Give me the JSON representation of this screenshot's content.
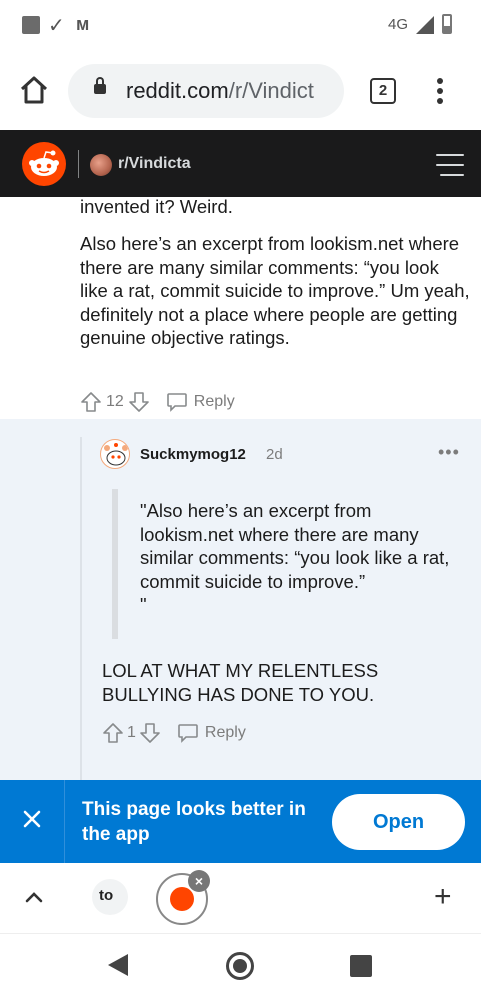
{
  "status_bar": {
    "network": "4G",
    "icons": [
      "app-square-icon",
      "check-icon",
      "malwarebytes-icon",
      "signal-icon",
      "battery-icon"
    ]
  },
  "browser": {
    "url_host": "reddit.com",
    "url_path": "/r/Vindict",
    "tab_count": "2"
  },
  "reddit_header": {
    "subreddit": "r/Vindicta",
    "brand_color": "#ff4500"
  },
  "parent_comment": {
    "text_top": "invented it? Weird.",
    "text_body": "Also here’s an excerpt from lookism.net where there are many similar comments: “you look like a rat, commit suicide to improve.” Um yeah, definitely not a place where people are getting genuine objective ratings.",
    "score": "12",
    "reply_label": "Reply"
  },
  "nested_comment": {
    "username": "Suckmymog12",
    "age": "2d",
    "more": "•••",
    "quote": "\"Also here’s an excerpt from lookism.net where there are many similar comments: “you look like a rat, commit suicide to improve.”\n\"",
    "text": "LOL AT WHAT MY RELENTLESS BULLYING HAS DONE TO YOU.",
    "score": "1",
    "reply_label": "Reply"
  },
  "app_banner": {
    "message": "This page looks better in the app",
    "open_label": "Open",
    "background": "#0079d3"
  },
  "tab_strip": {
    "tab1_label": "to",
    "plus": "+",
    "close": "×"
  }
}
